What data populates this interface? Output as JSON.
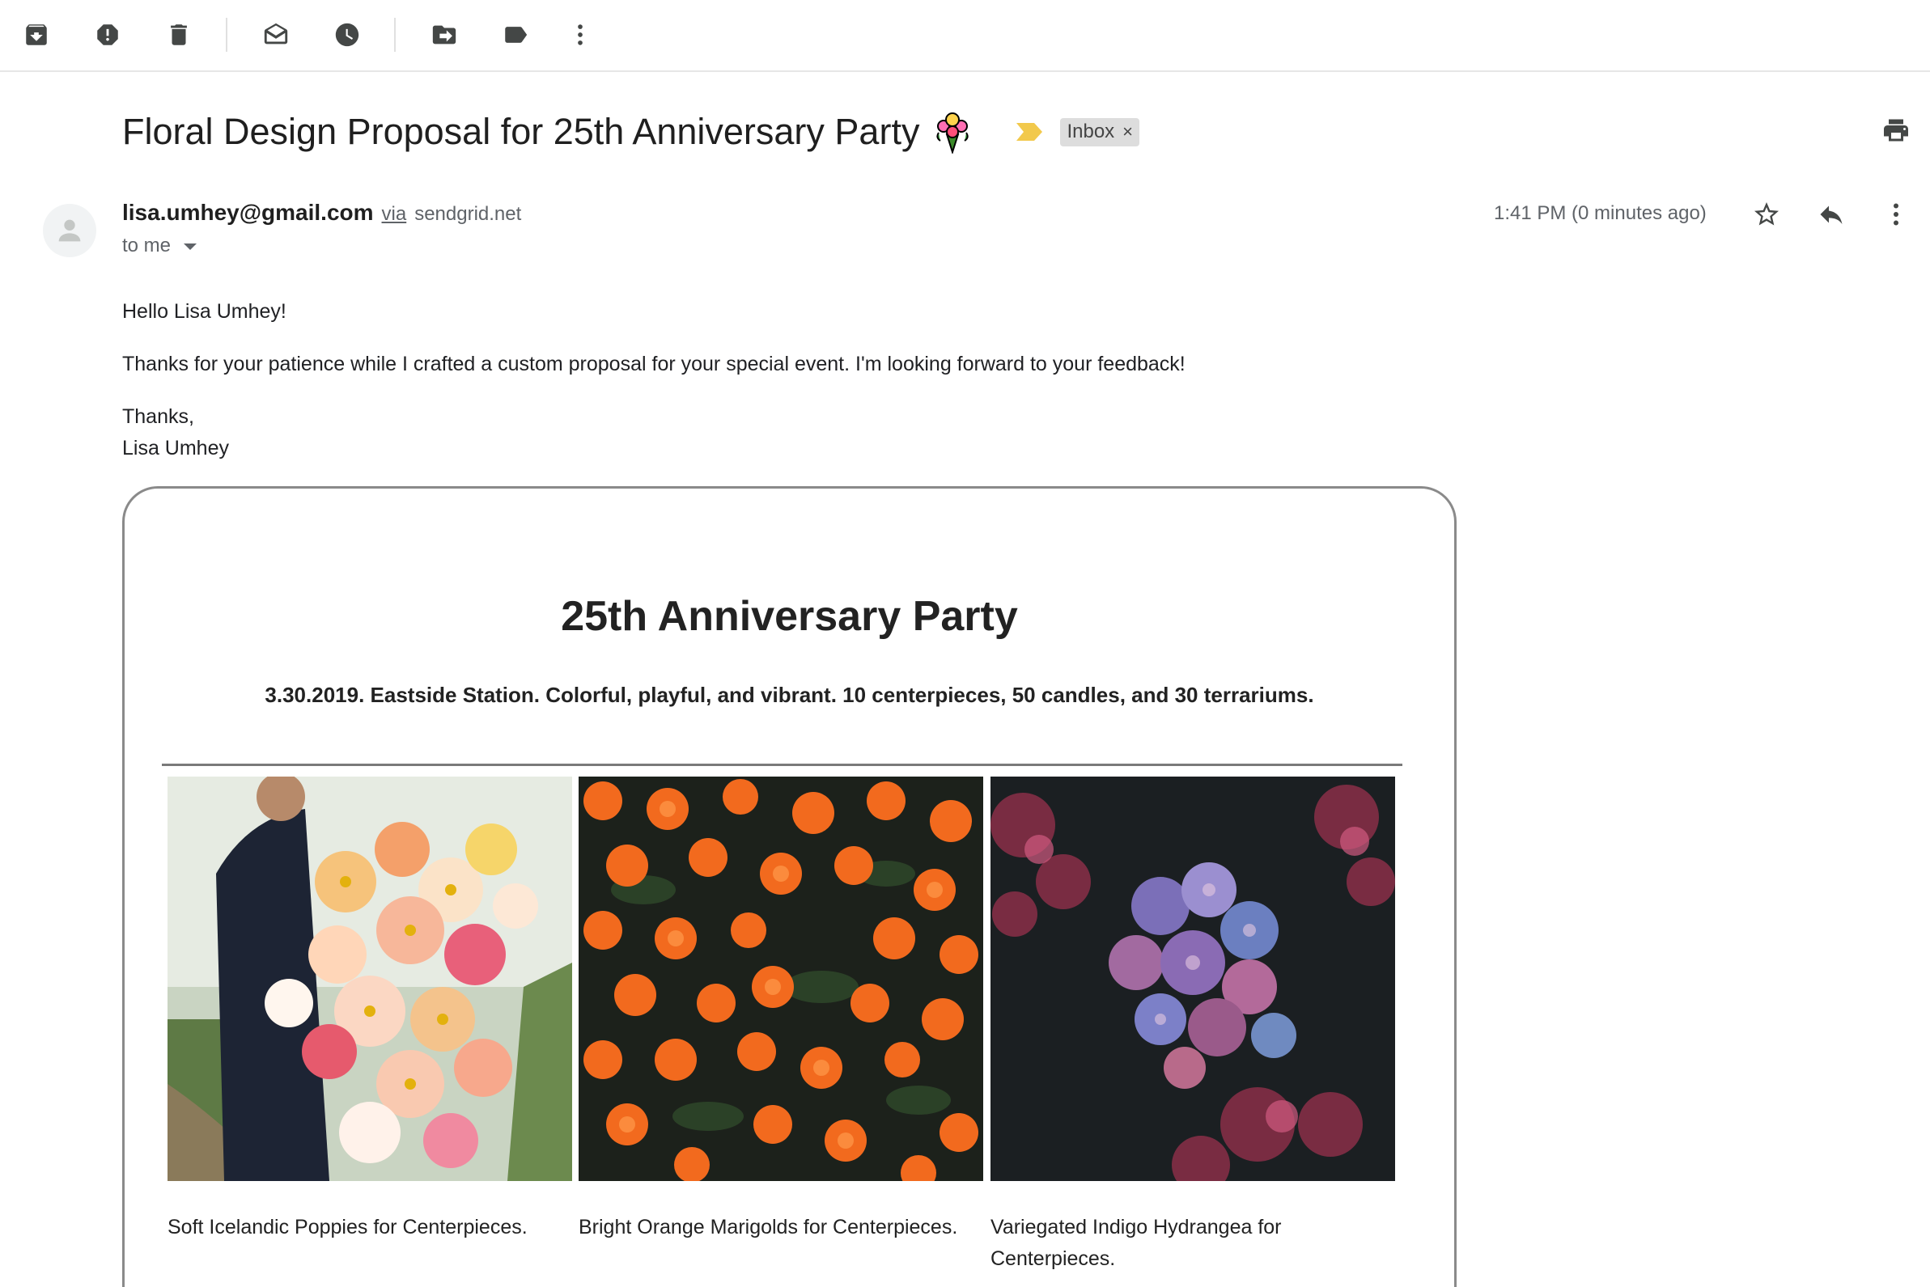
{
  "toolbar": {
    "archive": "archive-icon",
    "spam": "report-spam-icon",
    "delete": "delete-icon",
    "mark_unread": "mark-unread-icon",
    "snooze": "snooze-icon",
    "move": "move-to-icon",
    "label": "label-icon",
    "more": "more-vert-icon"
  },
  "subject": {
    "text": "Floral Design Proposal for 25th Anniversary Party",
    "label_chip": "Inbox",
    "chip_remove": "×"
  },
  "sender": {
    "email": "lisa.umhey@gmail.com",
    "via": "via",
    "via_domain": "sendgrid.net",
    "to": "to me",
    "timestamp": "1:41 PM (0 minutes ago)"
  },
  "body": {
    "greeting": "Hello Lisa Umhey!",
    "message": "Thanks for your patience while I crafted a custom proposal for your special event. I'm looking forward to your feedback!",
    "signoff": "Thanks,",
    "signature": "Lisa Umhey"
  },
  "proposal": {
    "title": "25th Anniversary Party",
    "details": "3.30.2019. Eastside Station. Colorful, playful, and vibrant. 10 centerpieces, 50 candles, and 30 terrariums.",
    "items": [
      {
        "caption": "Soft Icelandic Poppies for Centerpieces."
      },
      {
        "caption": "Bright Orange Marigolds for Centerpieces."
      },
      {
        "caption": "Variegated Indigo Hydrangea for Centerpieces."
      }
    ]
  },
  "colors": {
    "importance": "#f2c94c",
    "chip_bg": "#dddddd",
    "icon": "#444746"
  }
}
